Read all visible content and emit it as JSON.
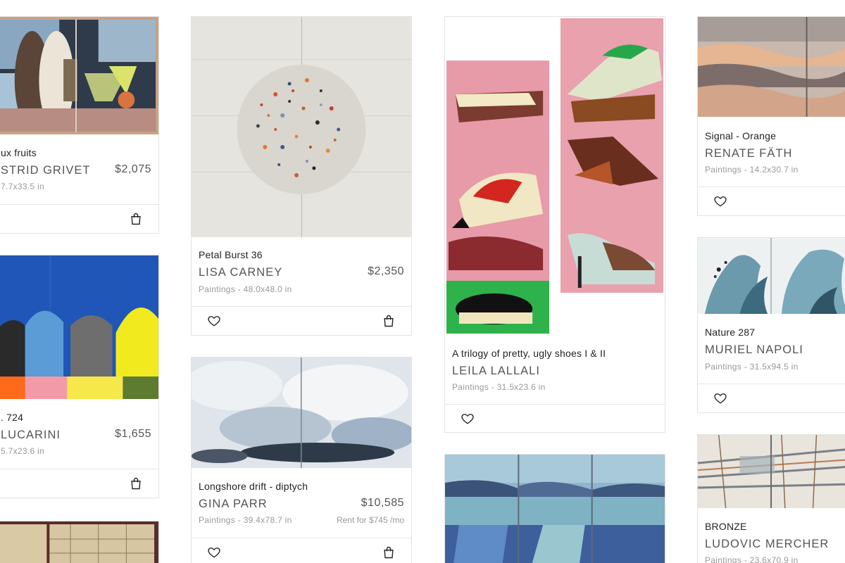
{
  "cards": [
    {
      "title": "ux fruits",
      "artist": "STRID GRIVET",
      "price": "$2,075",
      "meta": "7.7x33.5 in"
    },
    {
      "title": ". 724",
      "artist": "LUCARINI",
      "price": "$1,655",
      "meta": "5.7x23.6 in"
    },
    {
      "title": "Petal Burst 36",
      "artist": "LISA CARNEY",
      "price": "$2,350",
      "meta": "Paintings - 48.0x48.0 in"
    },
    {
      "title": "Longshore drift - diptych",
      "artist": "GINA PARR",
      "price": "$10,585",
      "meta": "Paintings - 39.4x78.7 in",
      "rent": "Rent for $745 /mo"
    },
    {
      "title": "A trilogy of pretty, ugly shoes I & II",
      "artist": "LEILA LALLALI",
      "meta": "Paintings - 31.5x23.6 in"
    },
    {
      "title": "Signal - Orange",
      "artist": "RENATE FÄTH",
      "meta": "Paintings - 14.2x30.7 in"
    },
    {
      "title": "Nature 287",
      "artist": "MURIEL NAPOLI",
      "meta": "Paintings - 31.5x94.5 in"
    },
    {
      "title": "BRONZE",
      "artist": "LUDOVIC MERCHER",
      "meta": "Paintings - 23.6x70.9 in"
    }
  ],
  "icons": {
    "favorite": "heart-outline-icon",
    "cart": "shopping-bag-icon"
  }
}
